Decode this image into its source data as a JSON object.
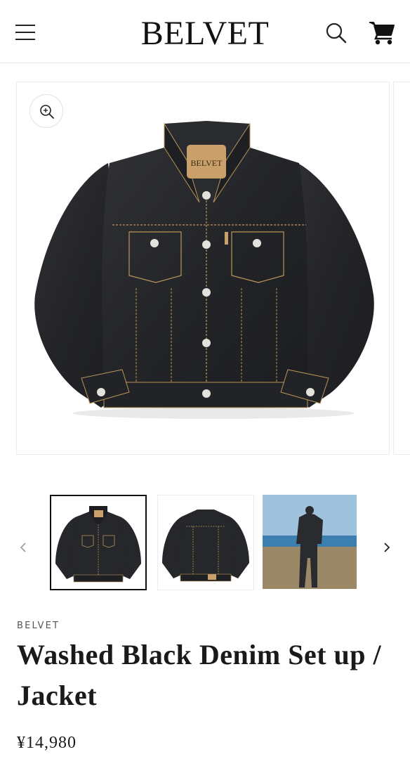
{
  "header": {
    "logo": "BELVET",
    "menu_icon": "hamburger-menu-icon",
    "search_icon": "search-icon",
    "cart_icon": "cart-icon"
  },
  "gallery": {
    "zoom_icon": "zoom-in-icon",
    "prev_icon": "chevron-left-icon",
    "next_icon": "chevron-right-icon",
    "patch_text": "BELVET",
    "selected_index": 0
  },
  "product": {
    "vendor": "BELVET",
    "title": "Washed Black Denim Set up / Jacket",
    "price": "¥14,980"
  },
  "colors": {
    "denim": "#26272a",
    "stitch": "#b9955a",
    "patch": "#c9a06a",
    "sky": "#9fc2dd",
    "sea": "#3d7fae",
    "sand": "#9a8866"
  }
}
